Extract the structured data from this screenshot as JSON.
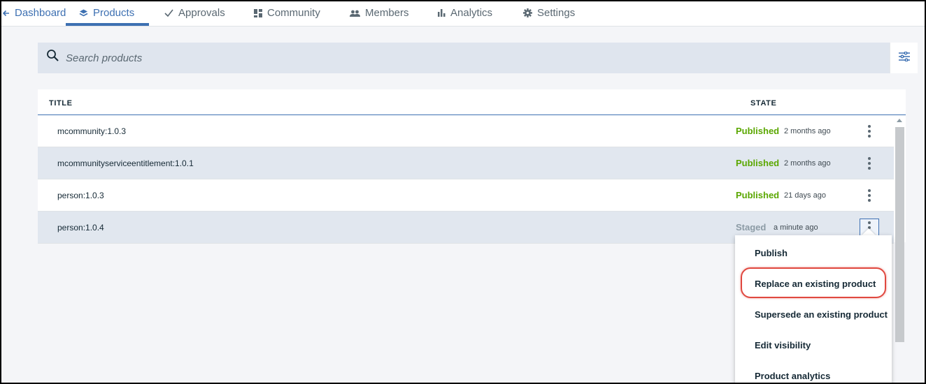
{
  "nav": {
    "back_label": "Dashboard",
    "tabs": [
      {
        "label": "Products",
        "icon": "layers-icon",
        "active": true
      },
      {
        "label": "Approvals",
        "icon": "checkmark-icon"
      },
      {
        "label": "Community",
        "icon": "dashboard-grid-icon"
      },
      {
        "label": "Members",
        "icon": "people-icon"
      },
      {
        "label": "Analytics",
        "icon": "bar-chart-icon"
      },
      {
        "label": "Settings",
        "icon": "gear-icon"
      }
    ]
  },
  "search": {
    "placeholder": "Search products"
  },
  "table": {
    "headers": {
      "title": "TITLE",
      "state": "STATE"
    },
    "rows": [
      {
        "title": "mcommunity:1.0.3",
        "state": "Published",
        "time": "2 months ago"
      },
      {
        "title": "mcommunityserviceentitlement:1.0.1",
        "state": "Published",
        "time": "2 months ago"
      },
      {
        "title": "person:1.0.3",
        "state": "Published",
        "time": "21 days ago"
      },
      {
        "title": "person:1.0.4",
        "state": "Staged",
        "time": "a minute ago"
      }
    ]
  },
  "menu": {
    "items": [
      {
        "label": "Publish"
      },
      {
        "label": "Replace an existing product",
        "highlighted": true
      },
      {
        "label": "Supersede an existing product"
      },
      {
        "label": "Edit visibility"
      },
      {
        "label": "Product analytics"
      }
    ]
  },
  "colors": {
    "accent": "#3d70b2",
    "published": "#5aa700",
    "staged": "#8c9ba5",
    "highlight_ring": "#e0483f"
  }
}
